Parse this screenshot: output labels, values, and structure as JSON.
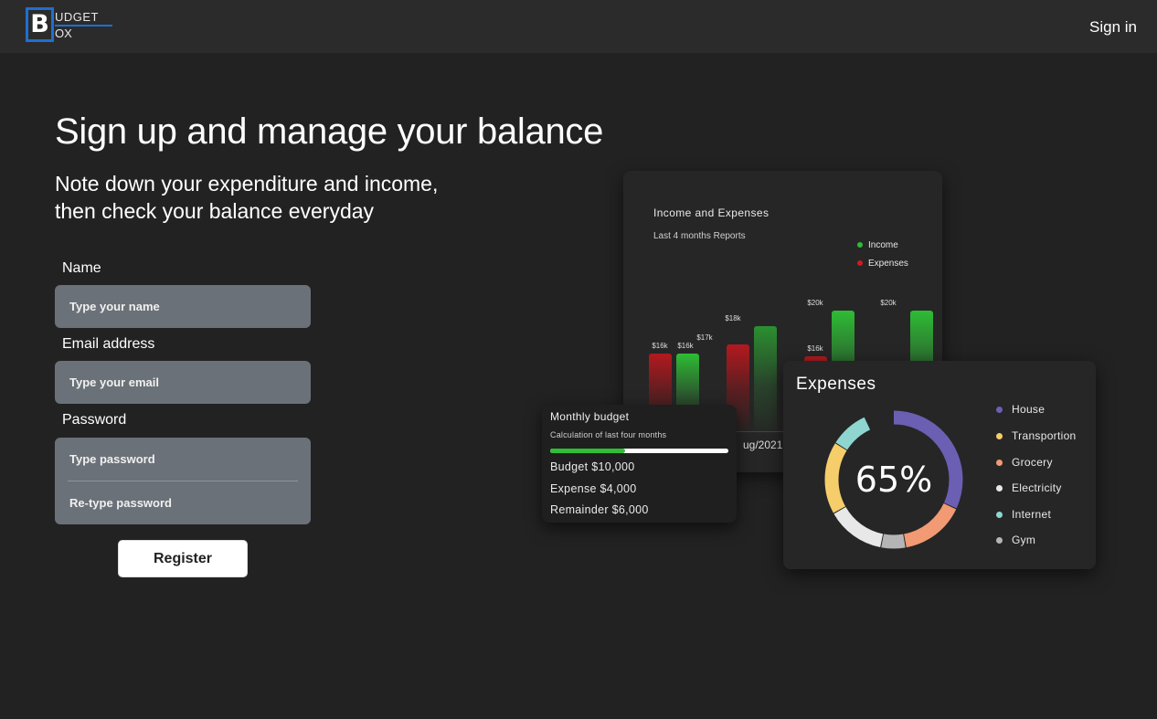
{
  "brand": {
    "letter": "B",
    "top": "UDGET",
    "bottom": "OX",
    "accent": "#1f6fd1"
  },
  "header": {
    "signin_label": "Sign in"
  },
  "hero": {
    "title": "Sign up and manage your balance",
    "subtitle_line1": "Note down your expenditure and income,",
    "subtitle_line2": "then check your balance everyday"
  },
  "form": {
    "name_label": "Name",
    "name_placeholder": "Type your name",
    "email_label": "Email address",
    "email_placeholder": "Type your email",
    "password_label": "Password",
    "password_placeholder": "Type password",
    "retype_placeholder": "Re-type password",
    "register_label": "Register"
  },
  "income_card": {
    "title": "Income and Expenses",
    "subtitle": "Last 4 months Reports",
    "legend": [
      {
        "label": "Income",
        "color": "#2ebc35"
      },
      {
        "label": "Expenses",
        "color": "#d01a1f"
      }
    ],
    "bar_labels": [
      "$16k",
      "$16k",
      "$17k",
      "$18k",
      "$20k",
      "$16k",
      "$20k"
    ],
    "axis_date": "ug/2021"
  },
  "expenses_card": {
    "title": "Expenses",
    "center": "65%",
    "legend": [
      {
        "label": "House",
        "color": "#6a5fb3"
      },
      {
        "label": "Transportion",
        "color": "#f5cd6a"
      },
      {
        "label": "Grocery",
        "color": "#f29a73"
      },
      {
        "label": "Electricity",
        "color": "#e8e8e8"
      },
      {
        "label": "Internet",
        "color": "#8ed6cf"
      },
      {
        "label": "Gym",
        "color": "#b5b5b5"
      }
    ]
  },
  "budget_card": {
    "title": "Monthly budget",
    "subtitle": "Calculation of last four months",
    "progress": 0.42,
    "budget": "Budget  $10,000",
    "expense": "Expense $4,000",
    "remainder": "Remainder $6,000"
  }
}
